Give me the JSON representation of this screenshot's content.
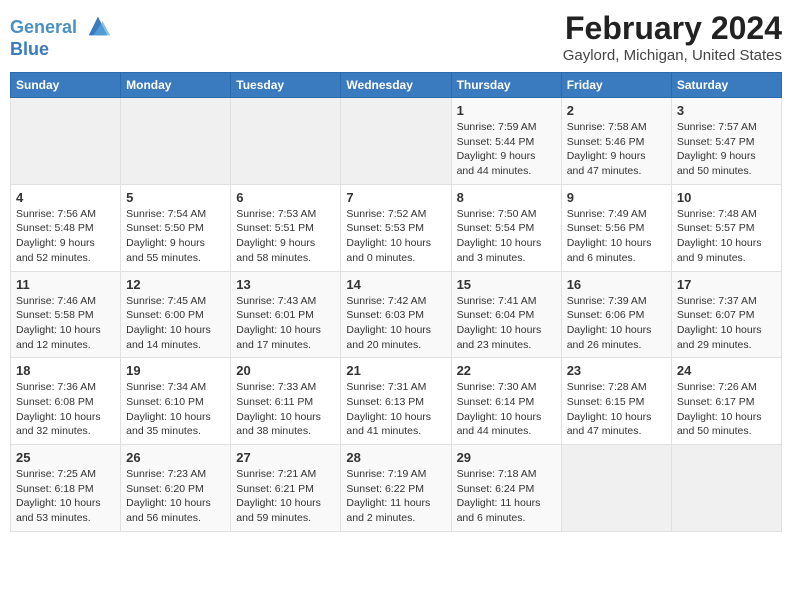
{
  "header": {
    "logo_line1": "General",
    "logo_line2": "Blue",
    "title": "February 2024",
    "subtitle": "Gaylord, Michigan, United States"
  },
  "days_of_week": [
    "Sunday",
    "Monday",
    "Tuesday",
    "Wednesday",
    "Thursday",
    "Friday",
    "Saturday"
  ],
  "weeks": [
    [
      {
        "day": "",
        "empty": true
      },
      {
        "day": "",
        "empty": true
      },
      {
        "day": "",
        "empty": true
      },
      {
        "day": "",
        "empty": true
      },
      {
        "day": "1",
        "sunrise": "7:59 AM",
        "sunset": "5:44 PM",
        "daylight": "9 hours and 44 minutes."
      },
      {
        "day": "2",
        "sunrise": "7:58 AM",
        "sunset": "5:46 PM",
        "daylight": "9 hours and 47 minutes."
      },
      {
        "day": "3",
        "sunrise": "7:57 AM",
        "sunset": "5:47 PM",
        "daylight": "9 hours and 50 minutes."
      }
    ],
    [
      {
        "day": "4",
        "sunrise": "7:56 AM",
        "sunset": "5:48 PM",
        "daylight": "9 hours and 52 minutes."
      },
      {
        "day": "5",
        "sunrise": "7:54 AM",
        "sunset": "5:50 PM",
        "daylight": "9 hours and 55 minutes."
      },
      {
        "day": "6",
        "sunrise": "7:53 AM",
        "sunset": "5:51 PM",
        "daylight": "9 hours and 58 minutes."
      },
      {
        "day": "7",
        "sunrise": "7:52 AM",
        "sunset": "5:53 PM",
        "daylight": "10 hours and 0 minutes."
      },
      {
        "day": "8",
        "sunrise": "7:50 AM",
        "sunset": "5:54 PM",
        "daylight": "10 hours and 3 minutes."
      },
      {
        "day": "9",
        "sunrise": "7:49 AM",
        "sunset": "5:56 PM",
        "daylight": "10 hours and 6 minutes."
      },
      {
        "day": "10",
        "sunrise": "7:48 AM",
        "sunset": "5:57 PM",
        "daylight": "10 hours and 9 minutes."
      }
    ],
    [
      {
        "day": "11",
        "sunrise": "7:46 AM",
        "sunset": "5:58 PM",
        "daylight": "10 hours and 12 minutes."
      },
      {
        "day": "12",
        "sunrise": "7:45 AM",
        "sunset": "6:00 PM",
        "daylight": "10 hours and 14 minutes."
      },
      {
        "day": "13",
        "sunrise": "7:43 AM",
        "sunset": "6:01 PM",
        "daylight": "10 hours and 17 minutes."
      },
      {
        "day": "14",
        "sunrise": "7:42 AM",
        "sunset": "6:03 PM",
        "daylight": "10 hours and 20 minutes."
      },
      {
        "day": "15",
        "sunrise": "7:41 AM",
        "sunset": "6:04 PM",
        "daylight": "10 hours and 23 minutes."
      },
      {
        "day": "16",
        "sunrise": "7:39 AM",
        "sunset": "6:06 PM",
        "daylight": "10 hours and 26 minutes."
      },
      {
        "day": "17",
        "sunrise": "7:37 AM",
        "sunset": "6:07 PM",
        "daylight": "10 hours and 29 minutes."
      }
    ],
    [
      {
        "day": "18",
        "sunrise": "7:36 AM",
        "sunset": "6:08 PM",
        "daylight": "10 hours and 32 minutes."
      },
      {
        "day": "19",
        "sunrise": "7:34 AM",
        "sunset": "6:10 PM",
        "daylight": "10 hours and 35 minutes."
      },
      {
        "day": "20",
        "sunrise": "7:33 AM",
        "sunset": "6:11 PM",
        "daylight": "10 hours and 38 minutes."
      },
      {
        "day": "21",
        "sunrise": "7:31 AM",
        "sunset": "6:13 PM",
        "daylight": "10 hours and 41 minutes."
      },
      {
        "day": "22",
        "sunrise": "7:30 AM",
        "sunset": "6:14 PM",
        "daylight": "10 hours and 44 minutes."
      },
      {
        "day": "23",
        "sunrise": "7:28 AM",
        "sunset": "6:15 PM",
        "daylight": "10 hours and 47 minutes."
      },
      {
        "day": "24",
        "sunrise": "7:26 AM",
        "sunset": "6:17 PM",
        "daylight": "10 hours and 50 minutes."
      }
    ],
    [
      {
        "day": "25",
        "sunrise": "7:25 AM",
        "sunset": "6:18 PM",
        "daylight": "10 hours and 53 minutes."
      },
      {
        "day": "26",
        "sunrise": "7:23 AM",
        "sunset": "6:20 PM",
        "daylight": "10 hours and 56 minutes."
      },
      {
        "day": "27",
        "sunrise": "7:21 AM",
        "sunset": "6:21 PM",
        "daylight": "10 hours and 59 minutes."
      },
      {
        "day": "28",
        "sunrise": "7:19 AM",
        "sunset": "6:22 PM",
        "daylight": "11 hours and 2 minutes."
      },
      {
        "day": "29",
        "sunrise": "7:18 AM",
        "sunset": "6:24 PM",
        "daylight": "11 hours and 6 minutes."
      },
      {
        "day": "",
        "empty": true
      },
      {
        "day": "",
        "empty": true
      }
    ]
  ]
}
